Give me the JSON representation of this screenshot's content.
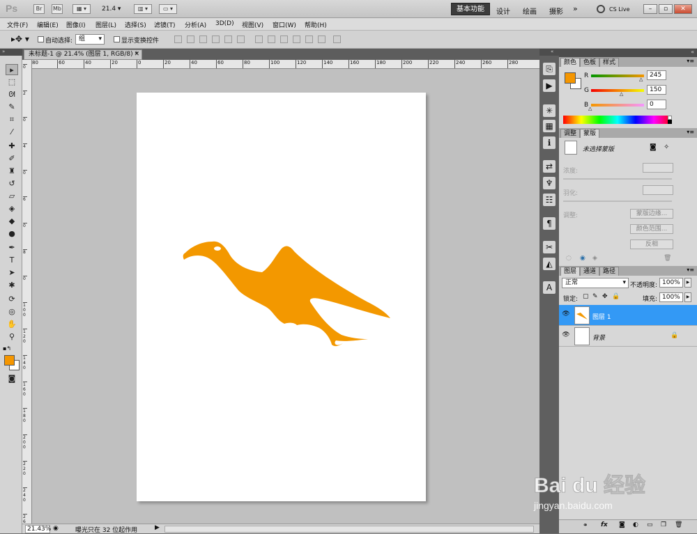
{
  "app": {
    "logo": "Ps",
    "bridge": "Br",
    "mini_bridge": "Mb",
    "zoom_value": "21.4",
    "workspaces": [
      "基本功能",
      "设计",
      "绘画",
      "摄影"
    ],
    "active_workspace": "基本功能",
    "more": "»",
    "cs_live": "CS Live",
    "win_controls": [
      "–",
      "▫",
      "✕"
    ]
  },
  "menu": [
    "文件(F)",
    "编辑(E)",
    "图像(I)",
    "图层(L)",
    "选择(S)",
    "滤镜(T)",
    "分析(A)",
    "3D(D)",
    "视图(V)",
    "窗口(W)",
    "帮助(H)"
  ],
  "options": {
    "auto_select_label": "自动选择:",
    "auto_select_value": "组",
    "show_transform_label": "显示变换控件"
  },
  "document": {
    "tab_title": "未标题-1 @ 21.4% (图层 1, RGB/8) *",
    "ruler_h": [
      "80",
      "60",
      "40",
      "20",
      "0",
      "20",
      "40",
      "60",
      "80",
      "100",
      "120",
      "140",
      "160",
      "180",
      "200",
      "220",
      "240",
      "260",
      "280"
    ],
    "ruler_v": [
      "0",
      "2",
      "0",
      "4",
      "0",
      "6",
      "0",
      "8",
      "0",
      "1 0 0",
      "1 2 0",
      "1 4 0",
      "1 6 0",
      "1 8 0",
      "2 0 0",
      "2 2 0",
      "2 4 0",
      "2 6 0",
      "2 8 0"
    ],
    "status_zoom": "21.43%",
    "status_text": "曝光只在 32 位起作用",
    "shape_color": "#f39800"
  },
  "color_panel": {
    "tabs": [
      "颜色",
      "色板",
      "样式"
    ],
    "fg_color": "#f59600",
    "channels": [
      {
        "label": "R",
        "value": "245",
        "fraction": 0.96
      },
      {
        "label": "G",
        "value": "150",
        "fraction": 0.59
      },
      {
        "label": "B",
        "value": "0",
        "fraction": 0.0
      }
    ]
  },
  "masks_panel": {
    "tabs": [
      "调整",
      "蒙版"
    ],
    "no_mask": "未选择蒙版",
    "density": "浓度:",
    "feather": "羽化:",
    "refine": "调整:",
    "mask_edge": "蒙版边缘...",
    "color_range": "颜色范围...",
    "invert": "反相"
  },
  "layers_panel": {
    "tabs": [
      "图层",
      "通道",
      "路径"
    ],
    "blend_mode": "正常",
    "opacity_label": "不透明度:",
    "opacity": "100%",
    "lock_label": "锁定:",
    "fill_label": "填充:",
    "fill": "100%",
    "layers": [
      {
        "name": "图层 1",
        "selected": true
      },
      {
        "name": "背景",
        "selected": false
      }
    ],
    "footer_icons": [
      "fx"
    ]
  },
  "watermark": {
    "brand": "Bai du 经验",
    "url": "jingyan.baidu.com"
  }
}
